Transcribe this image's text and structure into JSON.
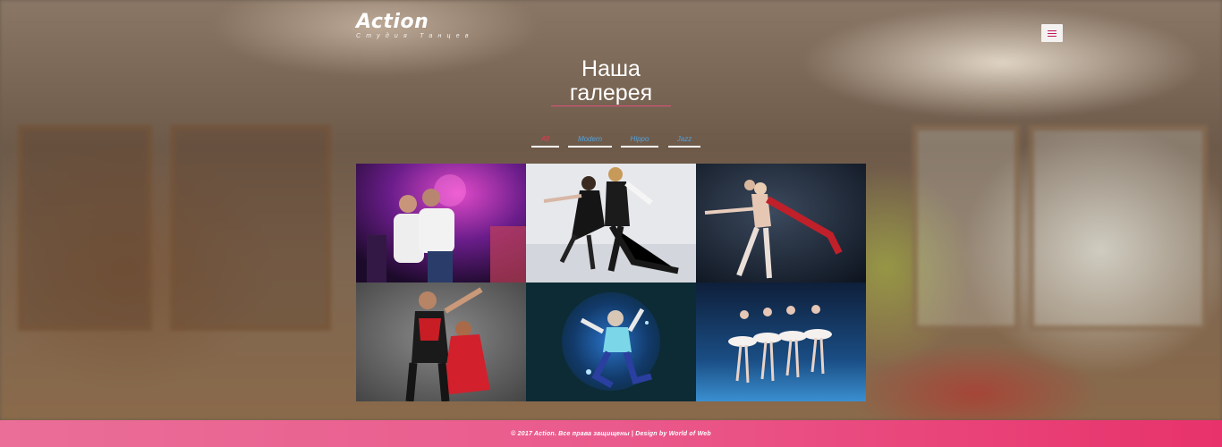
{
  "header": {
    "brand_name": "Action",
    "brand_tagline": "Студия Танцев",
    "menu_icon": "hamburger-icon"
  },
  "gallery_section": {
    "title_line1": "Наша",
    "title_line2": "галерея",
    "filters": [
      {
        "label": "All",
        "active": true
      },
      {
        "label": "Modern",
        "active": false
      },
      {
        "label": "Hippo",
        "active": false
      },
      {
        "label": "Jazz",
        "active": false
      }
    ],
    "images": [
      {
        "name": "gallery-image-club-couple"
      },
      {
        "name": "gallery-image-ice-dance"
      },
      {
        "name": "gallery-image-ballet-duo"
      },
      {
        "name": "gallery-image-latin-couple"
      },
      {
        "name": "gallery-image-hiphop-jump"
      },
      {
        "name": "gallery-image-swan-lake"
      }
    ]
  },
  "footer": {
    "text": "© 2017 Action. Все права защищены | Design by World of Web"
  },
  "colors": {
    "accent": "#e53950",
    "filter_link": "#4fa3e0",
    "footer_start": "#ea6e98",
    "footer_end": "#e8326b"
  }
}
